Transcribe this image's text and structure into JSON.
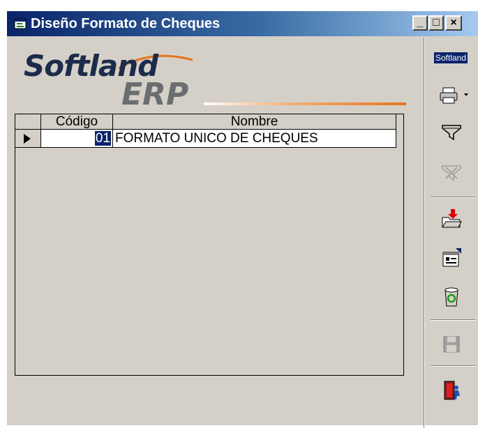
{
  "window": {
    "title": "Diseño Formato de Cheques",
    "controls": {
      "minimize": "_",
      "maximize": "□",
      "close": "×"
    }
  },
  "logo": {
    "line1": "Softland",
    "line2": "ERP"
  },
  "toolbar": {
    "brand": "Softland",
    "icons": [
      "printer-icon",
      "filter-icon",
      "clear-filter-icon",
      "import-icon",
      "properties-icon",
      "delete-icon",
      "save-icon",
      "exit-icon"
    ]
  },
  "grid": {
    "columns": [
      "Código",
      "Nombre"
    ],
    "rows": [
      {
        "codigo": "01",
        "nombre": "FORMATO UNICO DE CHEQUES"
      }
    ]
  }
}
